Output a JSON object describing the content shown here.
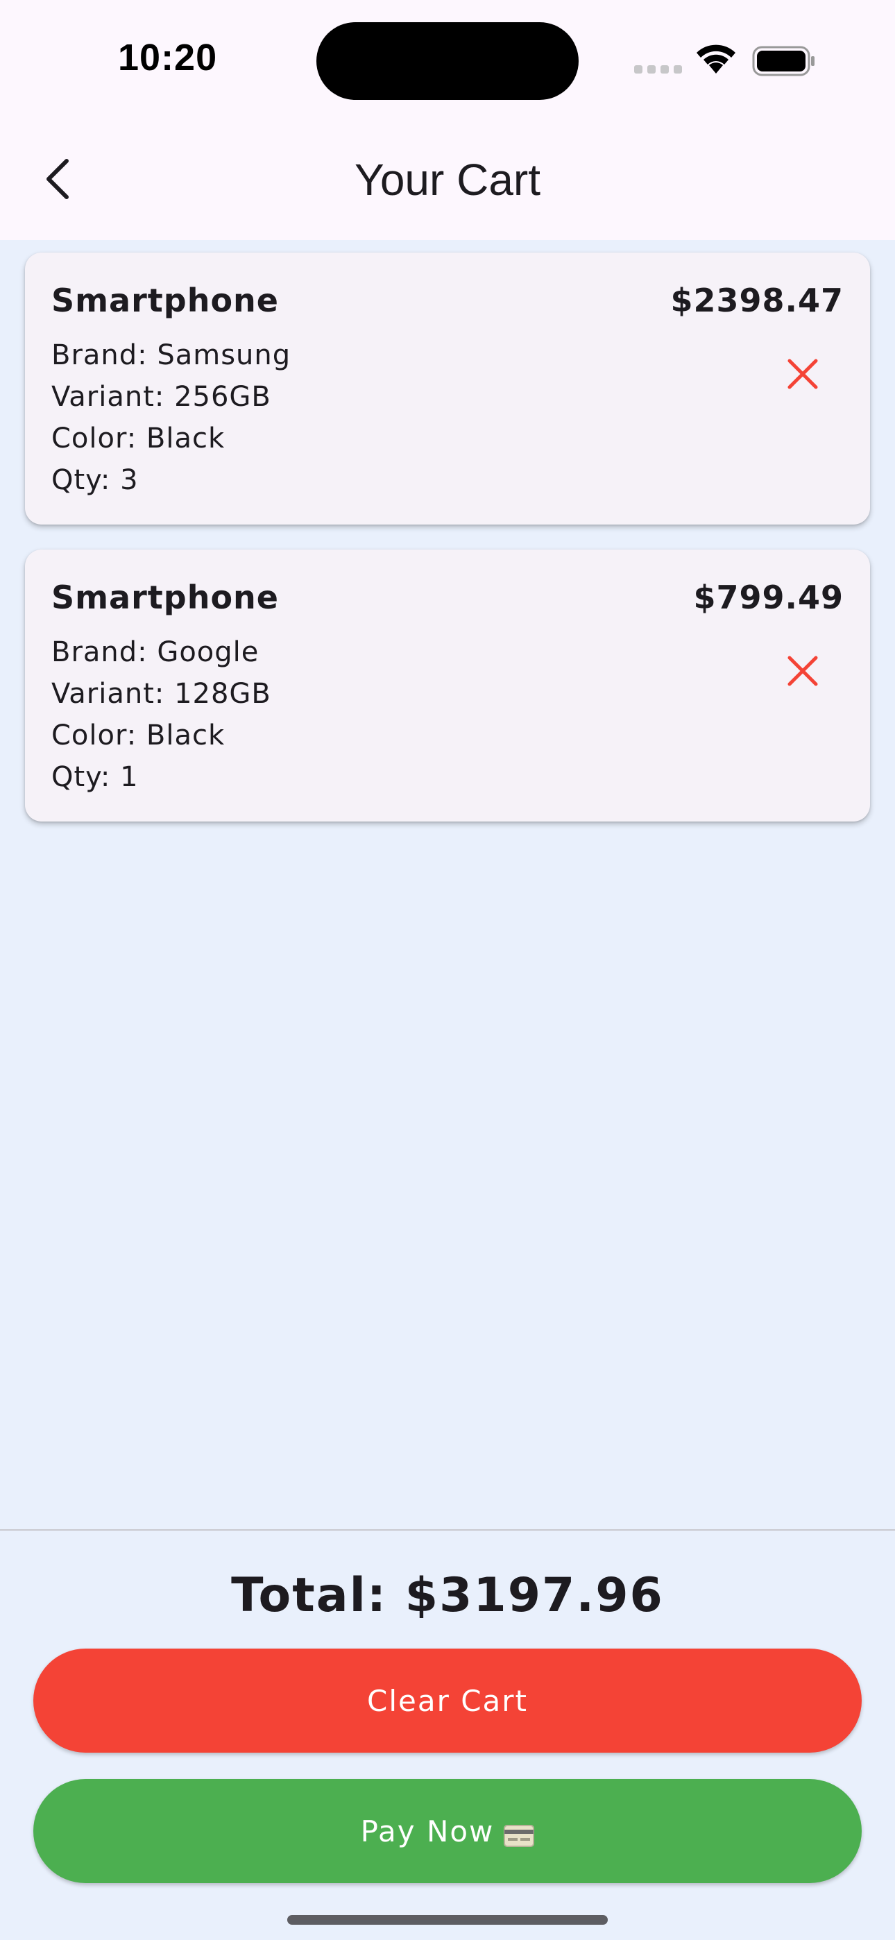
{
  "status_bar": {
    "time": "10:20"
  },
  "app_bar": {
    "title": "Your Cart",
    "back_icon": "chevron-left-icon"
  },
  "cart_items": [
    {
      "name": "Smartphone",
      "price": "$2398.47",
      "brand": "Brand: Samsung",
      "variant": "Variant: 256GB",
      "color": "Color: Black",
      "qty": "Qty: 3",
      "remove_icon": "close-icon"
    },
    {
      "name": "Smartphone",
      "price": "$799.49",
      "brand": "Brand: Google",
      "variant": "Variant: 128GB",
      "color": "Color: Black",
      "qty": "Qty: 1",
      "remove_icon": "close-icon"
    }
  ],
  "summary": {
    "total": "Total: $3197.96"
  },
  "actions": {
    "clear_label": "Clear Cart",
    "pay_label": "Pay Now",
    "pay_icon": "credit-card-icon"
  },
  "colors": {
    "background": "#e9f0fc",
    "app_bar": "#fdf7fe",
    "card": "#f6f2f8",
    "remove_red": "#f44336",
    "clear_button": "#f44336",
    "pay_button": "#4caf50"
  }
}
